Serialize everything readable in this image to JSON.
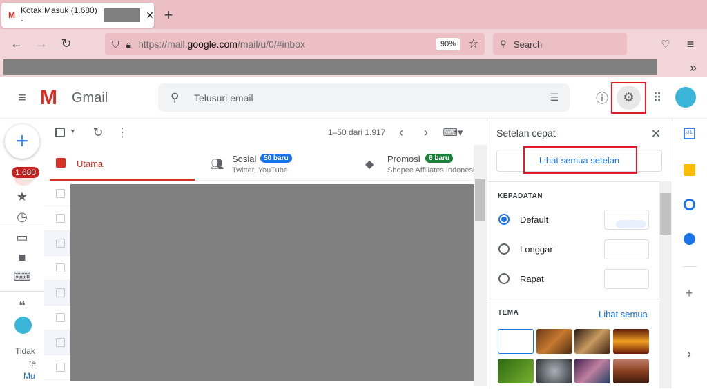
{
  "browser": {
    "tab_title": "Kotak Masuk (1.680) -",
    "url_prefix": "https://mail.",
    "url_domain": "google.com",
    "url_path": "/mail/u/0/#inbox",
    "zoom": "90%",
    "search_placeholder": "Search"
  },
  "gmail": {
    "logo": "Gmail",
    "search_placeholder": "Telusuri email",
    "unread_badge": "1.680",
    "pagination": "1–50 dari 1.917",
    "tabs": [
      {
        "label": "Utama"
      },
      {
        "label": "Sosial",
        "badge": "50 baru",
        "sub": "Twitter, YouTube"
      },
      {
        "label": "Promosi",
        "badge": "6 baru",
        "sub": "Shopee Affiliates Indonesia"
      }
    ],
    "chat_text": [
      "Tidak",
      "te",
      "Mu"
    ]
  },
  "quick_settings": {
    "title": "Setelan cepat",
    "see_all": "Lihat semua setelan",
    "density_heading": "KEPADATAN",
    "density_options": [
      {
        "label": "Default",
        "selected": true
      },
      {
        "label": "Longgar",
        "selected": false
      },
      {
        "label": "Rapat",
        "selected": false
      }
    ],
    "theme_heading": "TEMA",
    "theme_see_all": "Lihat semua"
  },
  "colors": {
    "accent": "#1a73e8",
    "highlight": "#e01b24",
    "inbox_red": "#d93025"
  }
}
